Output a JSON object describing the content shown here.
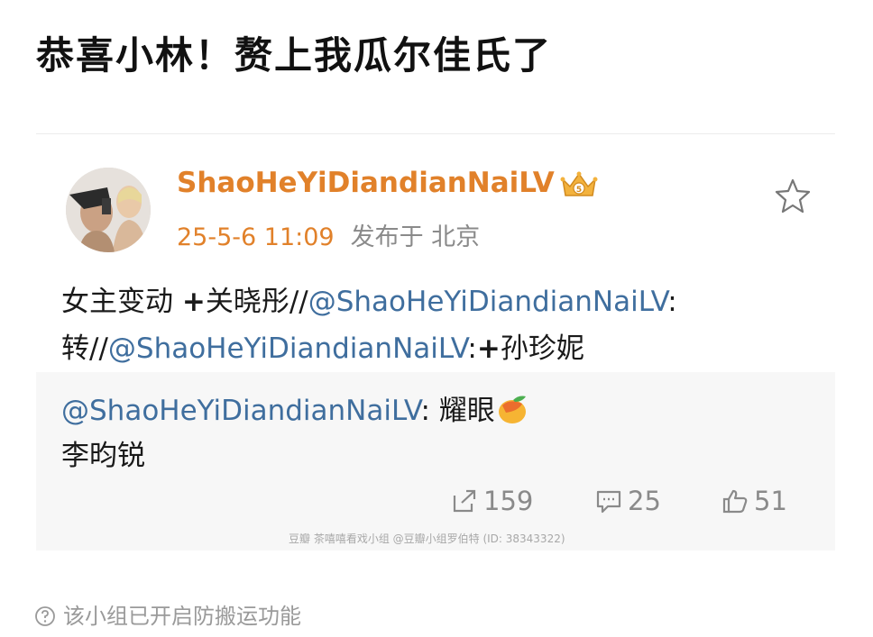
{
  "headline": "恭喜小林！赘上我瓜尔佳氏了",
  "post": {
    "username": "ShaoHeYiDiandianNaiLV",
    "time": "25-5-6 11:09",
    "location": "发布于 北京",
    "line1_prefix": "女主变动 ",
    "plus": "+",
    "line1_name": "关晓彤//",
    "mention": "@ShaoHeYiDiandianNaiLV",
    "colon": ":",
    "line2_prefix": "转//",
    "line2_name": "孙珍妮"
  },
  "repost": {
    "mention": "@ShaoHeYiDiandianNaiLV",
    "text": ": 耀眼",
    "line2": "李昀锐",
    "share_count": "159",
    "comment_count": "25",
    "like_count": "51",
    "watermark": "豆瓣  茶嘻嘻看戏小组 @豆瓣小组罗伯特 (ID: 38343322)"
  },
  "notice": "该小组已开启防搬运功能",
  "icons": {
    "vip": "vip-crown-icon",
    "favorite": "star-icon",
    "share": "share-icon",
    "comment": "comment-icon",
    "like": "thumbs-up-icon",
    "notice": "help-circle-icon",
    "emoji": "mango-emoji-icon"
  },
  "colors": {
    "username": "#e1812a",
    "mention": "#3f6e9e",
    "meta": "#8a8a8a",
    "repost_bg": "#f7f7f7"
  }
}
